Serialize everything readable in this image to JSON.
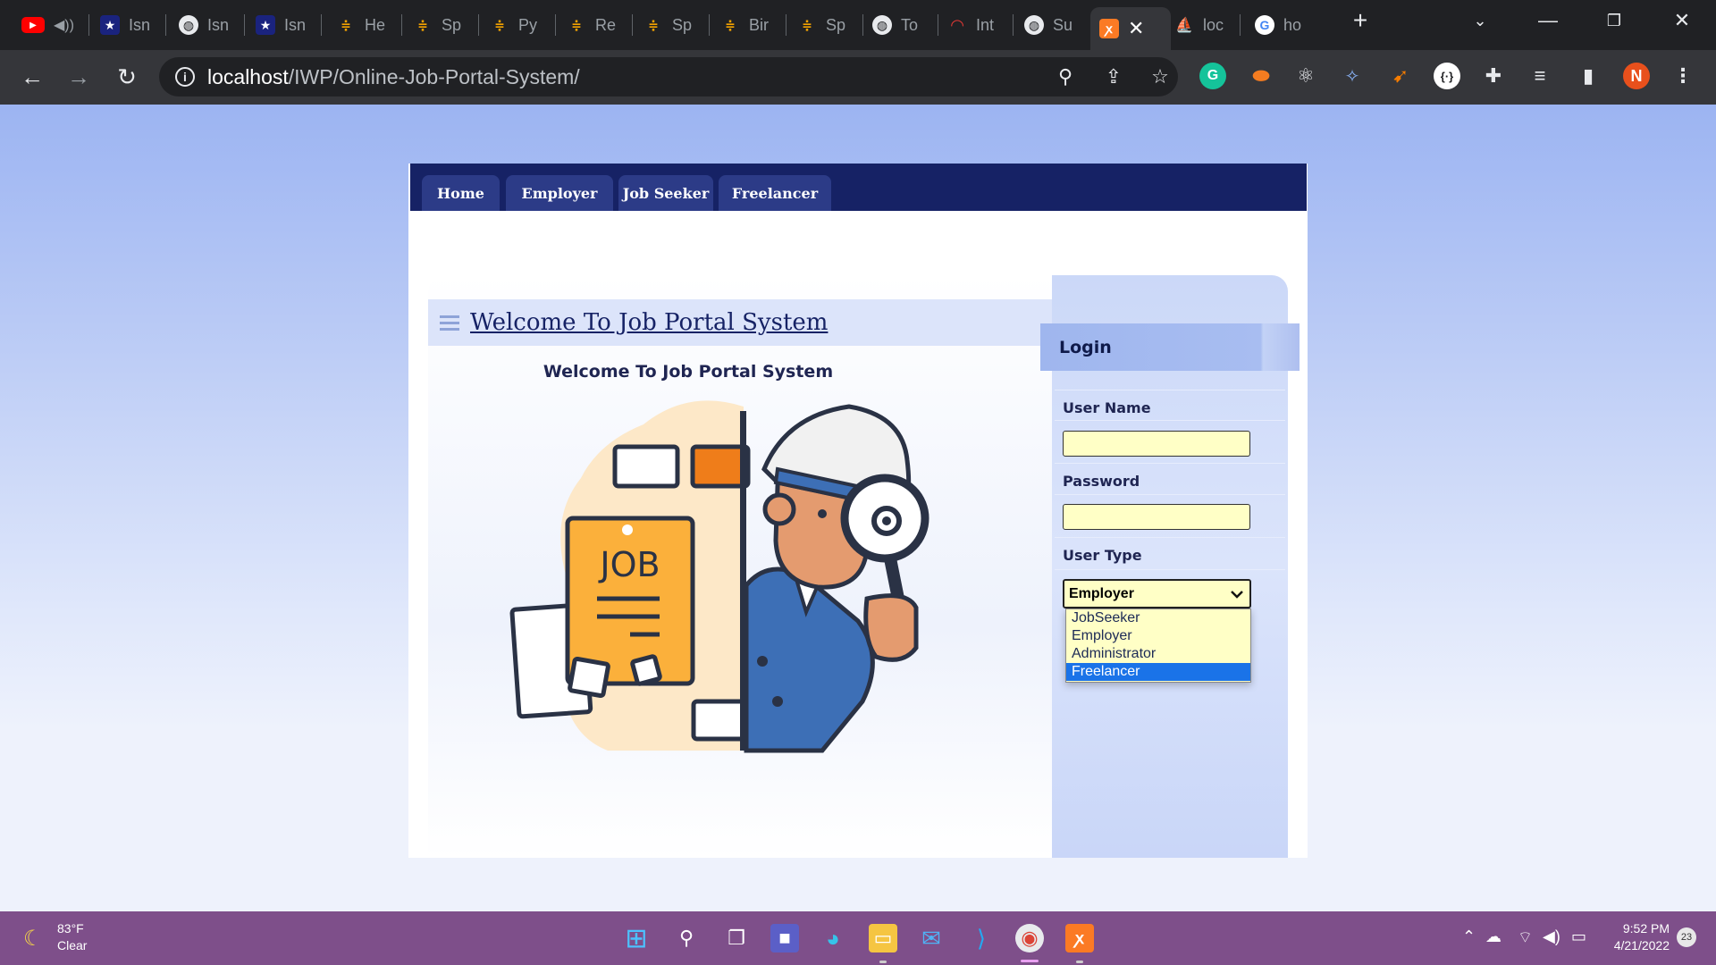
{
  "browser": {
    "tabs": [
      {
        "title": "",
        "icon": "youtube-icon"
      },
      {
        "title": "Isn",
        "icon": "star-icon"
      },
      {
        "title": "Isn",
        "icon": "globe-icon"
      },
      {
        "title": "Isn",
        "icon": "star-icon"
      },
      {
        "title": "He",
        "icon": "hackerrank-icon"
      },
      {
        "title": "Sp",
        "icon": "hackerrank-icon"
      },
      {
        "title": "Py",
        "icon": "hackerrank-icon"
      },
      {
        "title": "Re",
        "icon": "hackerrank-icon"
      },
      {
        "title": "Sp",
        "icon": "hackerrank-icon"
      },
      {
        "title": "Bir",
        "icon": "hackerrank-icon"
      },
      {
        "title": "Sp",
        "icon": "hackerrank-icon"
      },
      {
        "title": "To",
        "icon": "globe-icon"
      },
      {
        "title": "Int",
        "icon": "speedometer-icon"
      },
      {
        "title": "Su",
        "icon": "globe-icon"
      },
      {
        "title": "",
        "icon": "xampp-icon"
      },
      {
        "title": "loc",
        "icon": "phpmyadmin-icon"
      },
      {
        "title": "ho",
        "icon": "google-icon"
      }
    ],
    "url_host": "localhost",
    "url_path": "/IWP/Online-Job-Portal-System/",
    "profile_initial": "N"
  },
  "nav": {
    "items": [
      "Home",
      "Employer",
      "Job Seeker",
      "Freelancer"
    ]
  },
  "content": {
    "heading_link": "Welcome To Job Portal System",
    "welcome_text": "Welcome To Job Portal System",
    "illustration_label": "JOB"
  },
  "login": {
    "title": "Login",
    "username_label": "User Name",
    "password_label": "Password",
    "usertype_label": "User Type",
    "usertype_selected": "Employer",
    "usertype_options": [
      "JobSeeker",
      "Employer",
      "Administrator",
      "Freelancer"
    ],
    "highlighted_option": "Freelancer"
  },
  "taskbar": {
    "temperature": "83°F",
    "weather": "Clear",
    "time": "9:52 PM",
    "date": "4/21/2022",
    "notifications": "23"
  }
}
